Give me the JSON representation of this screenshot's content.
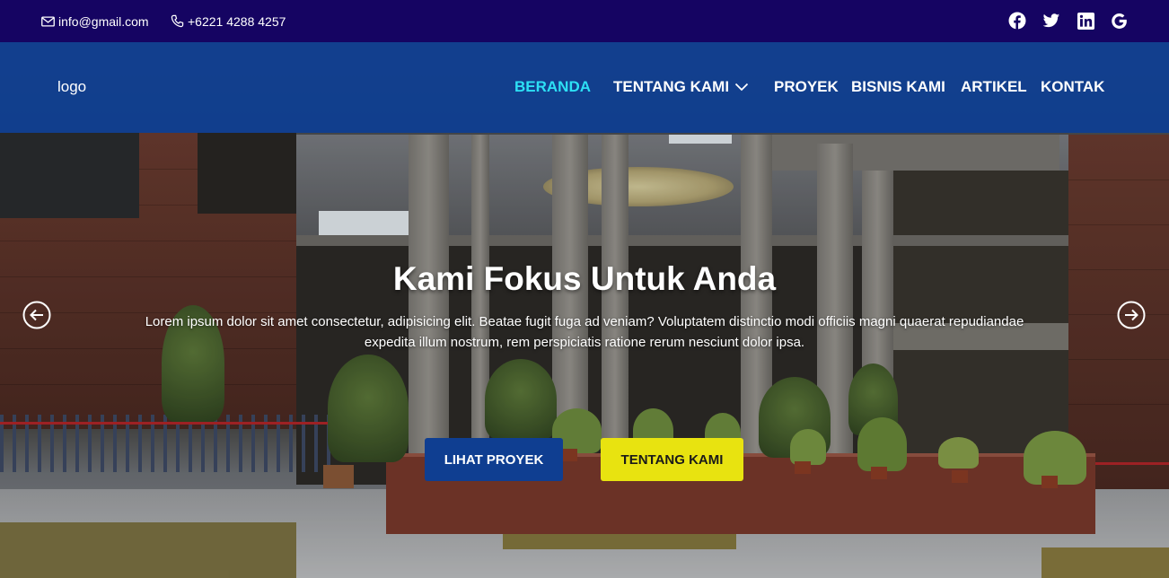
{
  "topbar": {
    "email": "info@gmail.com",
    "phone": "+6221 4288 4257",
    "social": [
      "facebook-icon",
      "twitter-icon",
      "linkedin-icon",
      "google-icon"
    ]
  },
  "navbar": {
    "logo": "logo",
    "items": [
      {
        "label": "BERANDA",
        "active": true
      },
      {
        "label": "TENTANG KAMI",
        "dropdown": true
      },
      {
        "label": "PROYEK"
      },
      {
        "label": "BISNIS KAMI"
      },
      {
        "label": "ARTIKEL"
      },
      {
        "label": "KONTAK"
      }
    ]
  },
  "hero": {
    "title": "Kami Fokus Untuk Anda",
    "description": "Lorem ipsum dolor sit amet consectetur, adipisicing elit. Beatae fugit fuga ad veniam? Voluptatem distinctio modi officiis magni quaerat repudiandae expedita illum nostrum, rem perspiciatis ratione rerum nesciunt dolor ipsa.",
    "primary_button": "LIHAT PROYEK",
    "secondary_button": "TENTANG KAMI",
    "prev_icon": "arrow-left-circle-icon",
    "next_icon": "arrow-right-circle-icon"
  },
  "colors": {
    "topbar_bg": "#150462",
    "navbar_bg": "#0a3e96",
    "nav_active": "#2de0f5",
    "primary_button": "#0f3e91",
    "secondary_button": "#e8e310"
  }
}
